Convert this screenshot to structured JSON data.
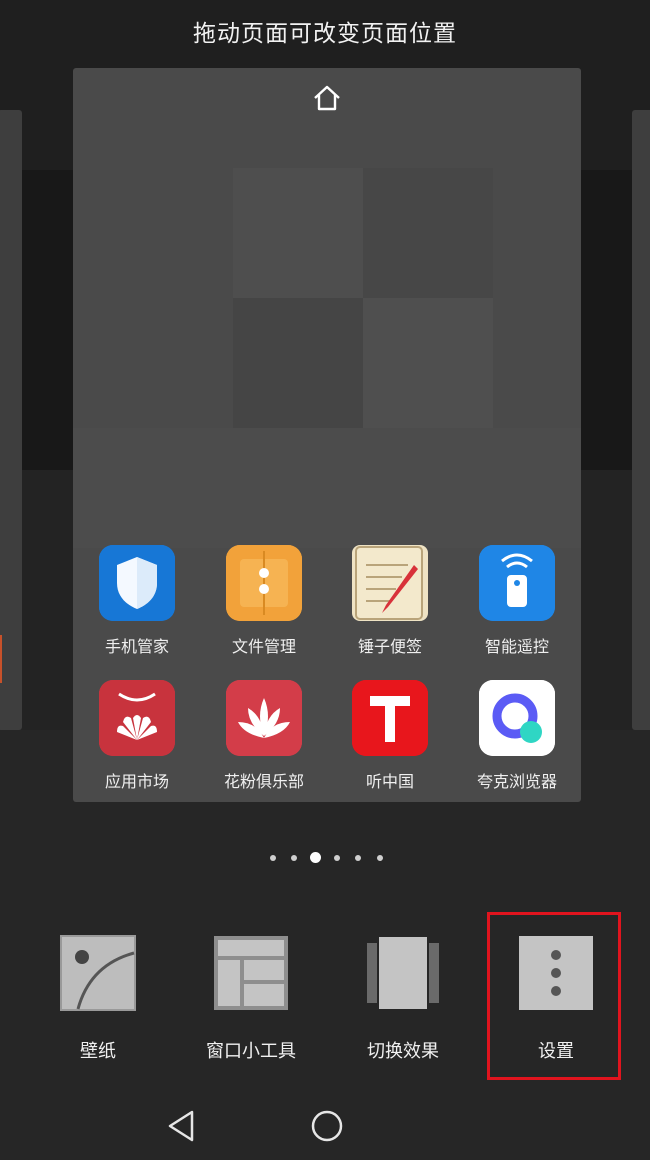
{
  "hint": "拖动页面可改变页面位置",
  "page": {
    "home_icon": "home-icon",
    "apps": [
      {
        "label": "手机管家",
        "icon": "phone-manager-shield-icon",
        "color": "#1a7fe0"
      },
      {
        "label": "文件管理",
        "icon": "file-manager-folder-icon",
        "color": "#f2a23a"
      },
      {
        "label": "锤子便签",
        "icon": "notes-pencil-icon",
        "color": "#efe3c4"
      },
      {
        "label": "智能遥控",
        "icon": "smart-remote-icon",
        "color": "#1f86e6"
      },
      {
        "label": "应用市场",
        "icon": "huawei-appgallery-icon",
        "color": "#d23b45"
      },
      {
        "label": "花粉俱乐部",
        "icon": "huafen-club-lotus-icon",
        "color": "#d9414d"
      },
      {
        "label": "听中国",
        "icon": "ting-china-t-icon",
        "color": "#e8161c"
      },
      {
        "label": "夸克浏览器",
        "icon": "quark-browser-icon",
        "color": "#ffffff"
      }
    ]
  },
  "page_indicator": {
    "count": 6,
    "active_index": 2
  },
  "toolbar": {
    "wallpaper": "壁纸",
    "widgets": "窗口小工具",
    "transition": "切换效果",
    "settings": "设置"
  },
  "navbar": {
    "back_icon": "back-triangle-icon",
    "home_icon": "home-circle-icon"
  },
  "highlight_color": "#e0141e"
}
